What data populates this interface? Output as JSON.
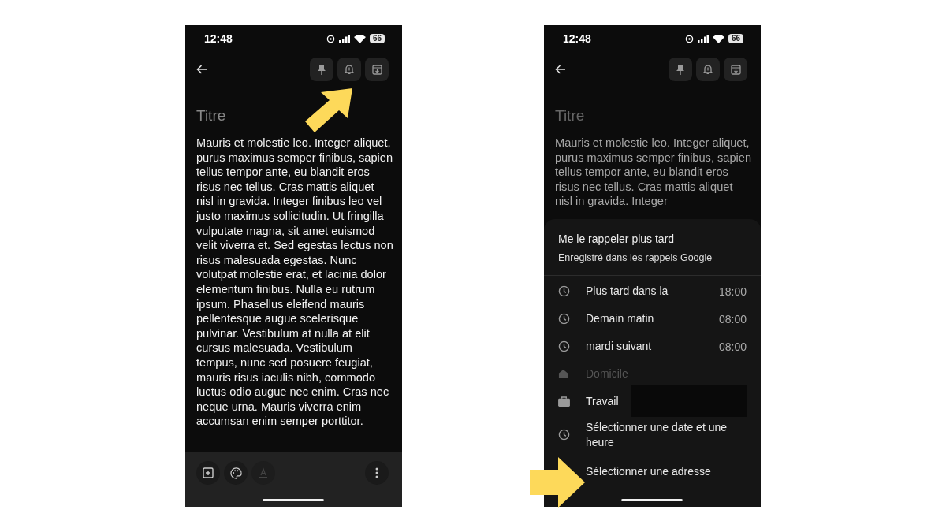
{
  "phones": [
    {
      "dimmed": false,
      "pointer": {
        "kind": "up-right"
      },
      "status": {
        "time": "12:48",
        "battery": "66"
      },
      "toolbar": [
        {
          "kind": "pin"
        },
        {
          "kind": "reminder"
        },
        {
          "kind": "archive"
        }
      ],
      "title": {
        "placeholder": "Titre"
      },
      "body": "Mauris et molestie leo. Integer aliquet, purus maximus semper finibus, sapien tellus tempor ante, eu blandit eros risus nec tellus. Cras mattis aliquet nisl in gravida. Integer finibus leo vel justo maximus sollicitudin. Ut fringilla vulputate magna, sit amet euismod velit viverra et. Sed egestas lectus non risus malesuada egestas. Nunc volutpat molestie erat, et lacinia dolor elementum finibus. Nulla eu rutrum ipsum. Phasellus eleifend mauris pellentesque augue scelerisque pulvinar. Vestibulum at nulla at elit cursus malesuada. Vestibulum tempus, nunc sed posuere feugiat, mauris risus iaculis nibh, commodo luctus odio augue nec enim. Cras nec neque urna. Mauris viverra enim accumsan enim semper porttitor.",
      "bottom_bar": [
        {
          "kind": "add",
          "disabled": false
        },
        {
          "kind": "palette",
          "disabled": false
        },
        {
          "kind": "text-format",
          "disabled": true
        },
        {
          "kind": "more",
          "disabled": false
        }
      ]
    },
    {
      "dimmed": true,
      "pointer": {
        "kind": "right"
      },
      "status": {
        "time": "12:48",
        "battery": "66"
      },
      "toolbar": [
        {
          "kind": "pin"
        },
        {
          "kind": "reminder"
        },
        {
          "kind": "archive"
        }
      ],
      "title": {
        "placeholder": "Titre"
      },
      "body": "Mauris et molestie leo. Integer aliquet, purus maximus semper finibus, sapien tellus tempor ante, eu blandit eros risus nec tellus. Cras mattis aliquet nisl in gravida. Integer",
      "sheet": {
        "title": "Me le rappeler plus tard",
        "subtitle": "Enregistré dans les rappels Google",
        "items": [
          {
            "kind": "clock",
            "label": "Plus tard dans la",
            "time": "18:00",
            "disabled": false,
            "redacted": false
          },
          {
            "kind": "clock",
            "label": "Demain matin",
            "time": "08:00",
            "disabled": false,
            "redacted": false
          },
          {
            "kind": "clock",
            "label": "mardi suivant",
            "time": "08:00",
            "disabled": false,
            "redacted": false
          },
          {
            "kind": "home",
            "label": "Domicile",
            "disabled": true,
            "redacted": false
          },
          {
            "kind": "work",
            "label": "Travail",
            "disabled": false,
            "redacted": true
          },
          {
            "kind": "clock",
            "label": "Sélectionner une date et une heure",
            "disabled": false,
            "redacted": false
          },
          {
            "kind": "none",
            "label": "Sélectionner une adresse",
            "disabled": false,
            "redacted": false
          }
        ]
      }
    }
  ]
}
